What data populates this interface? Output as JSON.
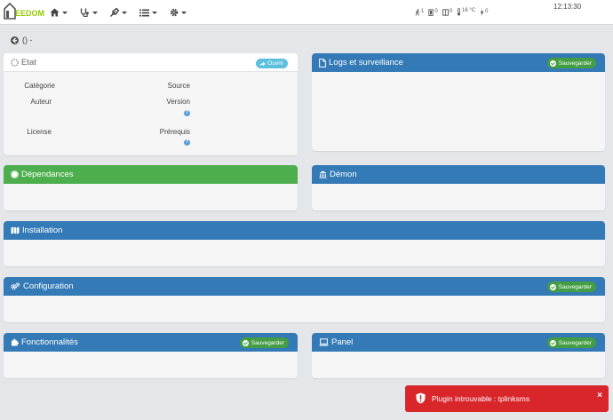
{
  "navbar": {
    "logo_text": "EEDOM",
    "menus": [
      {
        "icon": "home-icon"
      },
      {
        "icon": "stethoscope-icon"
      },
      {
        "icon": "wrench-icon"
      },
      {
        "icon": "list-icon"
      },
      {
        "icon": "gear-icon"
      }
    ],
    "status": [
      {
        "icon": "person-walking-icon",
        "value": "1"
      },
      {
        "icon": "door-icon",
        "value": "0"
      },
      {
        "icon": "window-icon",
        "value": "0"
      },
      {
        "icon": "thermometer-icon",
        "value": "16 °C"
      },
      {
        "icon": "bolt-icon",
        "value": "0"
      }
    ],
    "clock": "12:13:30"
  },
  "breadcrumb": {
    "text": "() -"
  },
  "etat": {
    "title": "Etat",
    "open_label": "Ouvrir",
    "fields": {
      "categorie": "Catégorie",
      "source": "Source",
      "auteur": "Auteur",
      "version": "Version",
      "license": "License",
      "prerequis": "Prérequis"
    }
  },
  "panels": {
    "logs": {
      "title": "Logs et surveillance",
      "save_label": "Sauvegarder"
    },
    "dependances": {
      "title": "Dépendances"
    },
    "demon": {
      "title": "Démon"
    },
    "installation": {
      "title": "Installation"
    },
    "configuration": {
      "title": "Configuration",
      "save_label": "Sauvegarder"
    },
    "fonctionnalites": {
      "title": "Fonctionnalités",
      "save_label": "Sauvegarder"
    },
    "panel": {
      "title": "Panel",
      "save_label": "Sauvegarder"
    }
  },
  "alert": {
    "message": "Plugin introuvable : tplinksms",
    "close": "×"
  },
  "colors": {
    "primary": "#337ab7",
    "success": "#4cae4c",
    "danger": "#d9262b",
    "info": "#5bc0de",
    "brand": "#94ca02"
  }
}
